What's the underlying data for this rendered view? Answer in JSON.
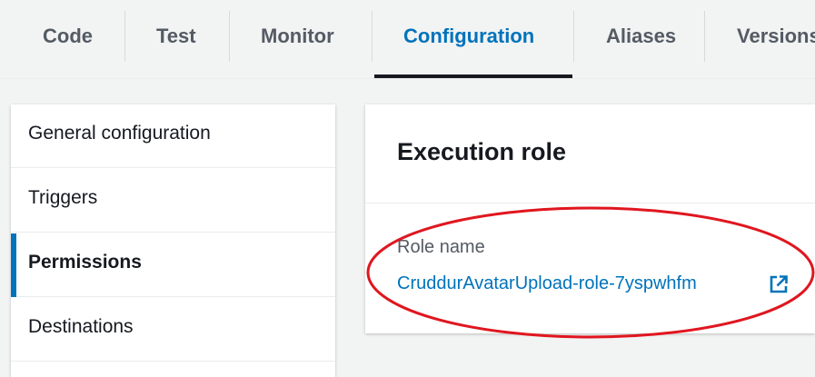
{
  "tabs": [
    {
      "label": "Code"
    },
    {
      "label": "Test"
    },
    {
      "label": "Monitor"
    },
    {
      "label": "Configuration",
      "active": true
    },
    {
      "label": "Aliases"
    },
    {
      "label": "Versions"
    }
  ],
  "sidenav": {
    "items": [
      {
        "label": "General configuration"
      },
      {
        "label": "Triggers"
      },
      {
        "label": "Permissions",
        "active": true
      },
      {
        "label": "Destinations"
      }
    ]
  },
  "execution_role": {
    "title": "Execution role",
    "role_name_label": "Role name",
    "role_name": "CruddurAvatarUpload-role-7yspwhfm",
    "link_icon": "external-link-icon"
  },
  "annotation": {
    "shape": "ellipse",
    "color": "#e0161f"
  },
  "colors": {
    "accent": "#0073bb",
    "text": "#16191f",
    "muted": "#545b64",
    "background": "#f2f3f3"
  }
}
